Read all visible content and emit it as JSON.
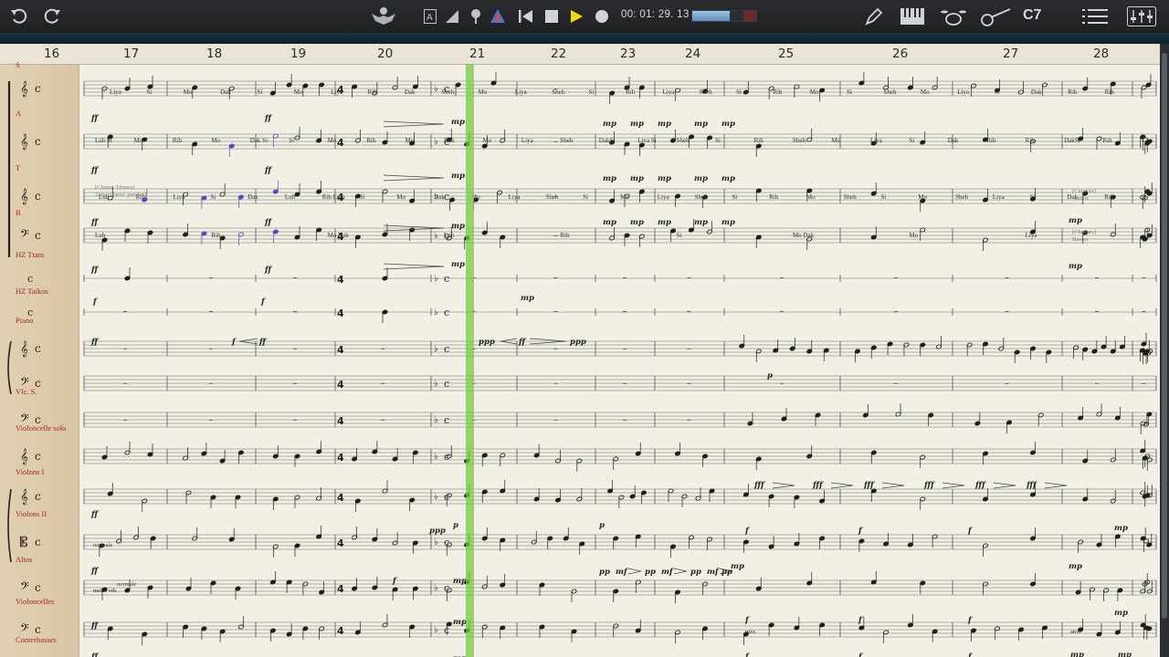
{
  "toolbar": {
    "time": "00: 01: 29. 13",
    "volume_fraction": 0.58,
    "chord": "C7",
    "icons": [
      "undo-icon",
      "redo-icon",
      "conductor-icon",
      "text-mode-icon",
      "dynamics-icon",
      "mic-icon",
      "tuner-icon",
      "rewind-icon",
      "stop-icon",
      "play-icon",
      "record-icon",
      "pen-icon",
      "keyboard-icon",
      "drums-icon",
      "guitar-icon",
      "menu-icon",
      "mixer-icon"
    ],
    "accent_play": "#f0e000"
  },
  "measures": [
    "16",
    "17",
    "18",
    "19",
    "20",
    "21",
    "22",
    "23",
    "24",
    "25",
    "26",
    "27",
    "28"
  ],
  "instruments": [
    {
      "name": "S"
    },
    {
      "name": "A"
    },
    {
      "name": "T"
    },
    {
      "name": "B"
    },
    {
      "name": "HZ Ttam"
    },
    {
      "name": "HZ Taikos"
    },
    {
      "name": "Piano"
    },
    {
      "name": "Vlc. S."
    },
    {
      "name": "Violoncelle solo"
    },
    {
      "name": "Violons I"
    },
    {
      "name": "Violons II"
    },
    {
      "name": "Altos"
    },
    {
      "name": "Violoncelles"
    },
    {
      "name": "Contrebasses"
    }
  ],
  "annotations": {
    "choeur_tenors": "[Choeur Ténors]",
    "tenors_sub": "Ténors (avec paroles)",
    "choeurs_tenors_r": "[Choeurs]",
    "tenors_r": "Ténors",
    "choeurs_basses_r": "[Choeurs]",
    "basses_r": "Basses",
    "normale": "normale",
    "molto_vib": "molto vib.",
    "pizz": "pizz.",
    "arco": "arco"
  },
  "lyrics_s": [
    "Liya",
    "Si",
    "Mo",
    "Dak",
    "Si",
    "Mo",
    "Liya",
    "Rih",
    "Dak",
    "Sheh",
    "Mo",
    "Liya",
    "Sheh",
    "Si",
    "Rih",
    "Liya",
    "Sheh",
    "Si",
    "Rih",
    "Mo",
    "Si",
    "Sheh",
    "Mo",
    "Liya",
    "Si",
    "Dak",
    "Rih",
    "Rih"
  ],
  "lyrics_a": [
    "Luh Si",
    "Mo",
    "Rih",
    "Mo",
    "Dak Si",
    "Si",
    "Mo",
    "Rih",
    "Mo",
    "Dak",
    "Mo",
    "Liya",
    "Sheh",
    "DakSi",
    "Liya Si",
    "Sheh",
    "Si",
    "Rih",
    "Sheh",
    "Mo",
    "Liya",
    "Si",
    "Dak",
    "Rih",
    "Rih",
    "DakSi",
    "Rih"
  ],
  "lyrics_t": [
    "Luh",
    "Rih",
    "Liya",
    "Si",
    "Dak",
    "Luh",
    "Rih Liya",
    "Si",
    "Mo",
    "Dak",
    "Mo",
    "Liya",
    "Sheh",
    "Si",
    "Mo",
    "Liya",
    "Sheh",
    "Si",
    "Rih",
    "Mo",
    "Sheh",
    "Si",
    "Mo",
    "Sheh",
    "Liya",
    "Si",
    "Dak",
    "Rih"
  ],
  "lyrics_b": [
    "Luh",
    "Rih",
    "Mo Dak",
    "Luh",
    "Rih",
    "Si",
    "Mo Dak",
    "Mo",
    "Liya"
  ],
  "dynamics": {
    "ff": "ff",
    "f": "f",
    "mp": "mp",
    "ppp": "ppp",
    "pp": "pp",
    "mf": "mf",
    "p": "p",
    "fff": "fff"
  }
}
